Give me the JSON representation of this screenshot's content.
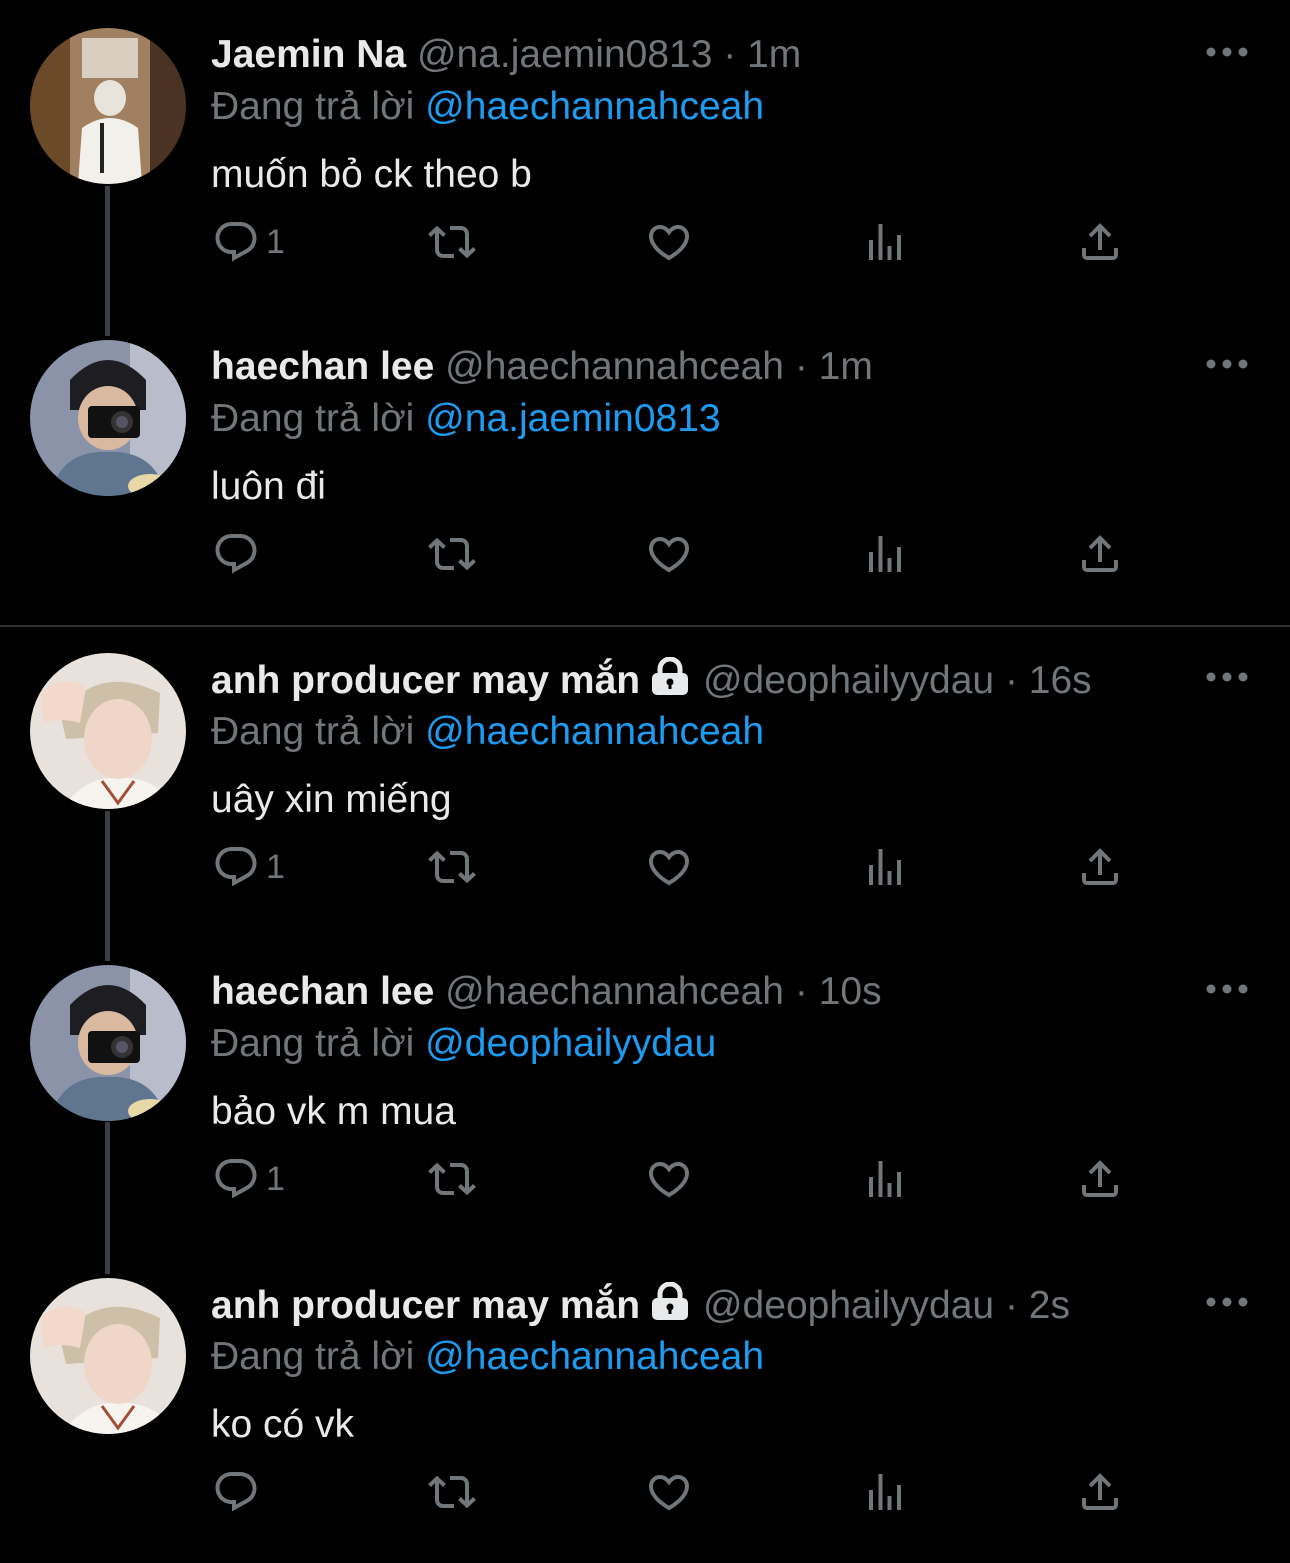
{
  "tweets": [
    {
      "name": "Jaemin Na",
      "locked": false,
      "handle": "@na.jaemin0813",
      "dot": "·",
      "time": "1m",
      "reply_prefix": "Đang trả lời",
      "reply_to": "@haechannahceah",
      "text": "muốn bỏ ck theo b",
      "reply_count": "1",
      "avatar": "avatar-jaemin"
    },
    {
      "name": "haechan lee",
      "locked": false,
      "handle": "@haechannahceah",
      "dot": "·",
      "time": "1m",
      "reply_prefix": "Đang trả lời",
      "reply_to": "@na.jaemin0813",
      "text": "luôn đi",
      "reply_count": "",
      "avatar": "avatar-haechan"
    },
    {
      "name": "anh producer may mắn",
      "locked": true,
      "handle": "@deophailyydau",
      "dot": "·",
      "time": "16s",
      "reply_prefix": "Đang trả lời",
      "reply_to": "@haechannahceah",
      "text": "uây xin miếng",
      "reply_count": "1",
      "avatar": "avatar-producer"
    },
    {
      "name": "haechan lee",
      "locked": false,
      "handle": "@haechannahceah",
      "dot": "·",
      "time": "10s",
      "reply_prefix": "Đang trả lời",
      "reply_to": "@deophailyydau",
      "text": "bảo vk m mua",
      "reply_count": "1",
      "avatar": "avatar-haechan"
    },
    {
      "name": "anh producer may mắn",
      "locked": true,
      "handle": "@deophailyydau",
      "dot": "·",
      "time": "2s",
      "reply_prefix": "Đang trả lời",
      "reply_to": "@haechannahceah",
      "text": "ko có vk",
      "reply_count": "",
      "avatar": "avatar-producer"
    }
  ],
  "icons": {
    "reply": "reply-icon",
    "retweet": "retweet-icon",
    "like": "heart-icon",
    "views": "views-icon",
    "share": "share-icon",
    "more": "more-icon",
    "lock": "lock-icon"
  },
  "colors": {
    "background": "#000000",
    "text": "#e7e9ea",
    "muted": "#71767b",
    "mention": "#1d9bf0"
  }
}
